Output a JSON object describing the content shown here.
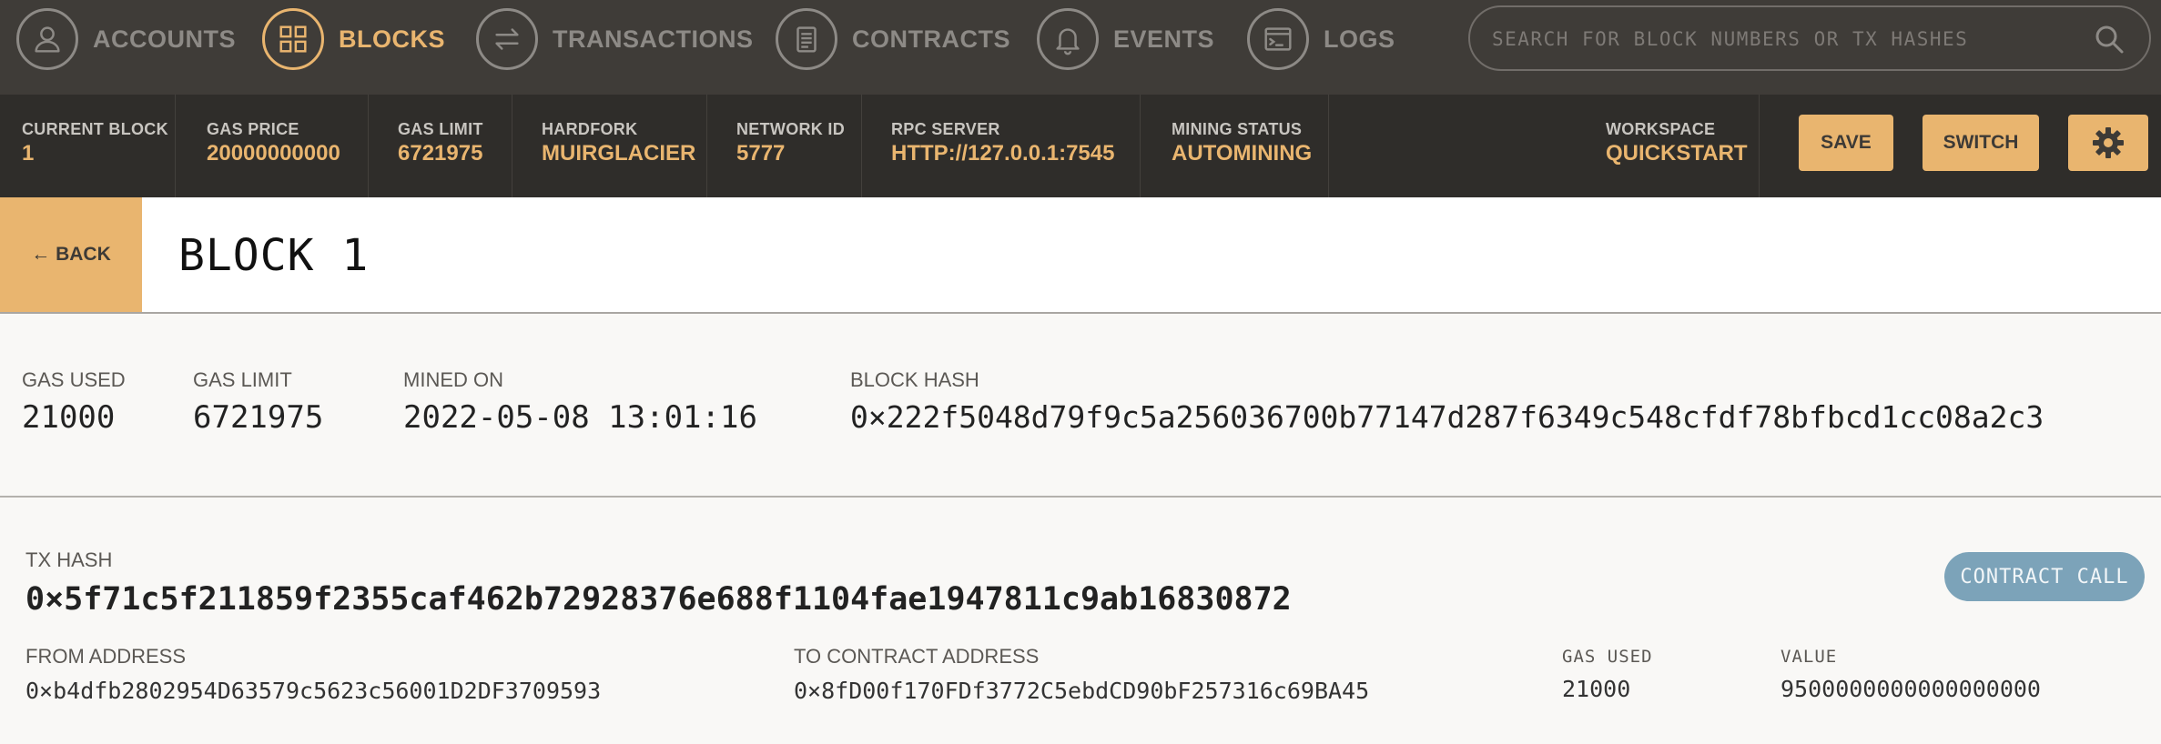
{
  "nav": {
    "items": [
      {
        "label": "ACCOUNTS",
        "icon": "user-icon"
      },
      {
        "label": "BLOCKS",
        "icon": "grid-icon",
        "active": true
      },
      {
        "label": "TRANSACTIONS",
        "icon": "arrows-icon"
      },
      {
        "label": "CONTRACTS",
        "icon": "document-icon"
      },
      {
        "label": "EVENTS",
        "icon": "bell-icon"
      },
      {
        "label": "LOGS",
        "icon": "terminal-icon"
      }
    ],
    "search_placeholder": "SEARCH FOR BLOCK NUMBERS OR TX HASHES"
  },
  "status": {
    "current_block": {
      "label": "CURRENT BLOCK",
      "value": "1"
    },
    "gas_price": {
      "label": "GAS PRICE",
      "value": "20000000000"
    },
    "gas_limit": {
      "label": "GAS LIMIT",
      "value": "6721975"
    },
    "hardfork": {
      "label": "HARDFORK",
      "value": "MUIRGLACIER"
    },
    "network_id": {
      "label": "NETWORK ID",
      "value": "5777"
    },
    "rpc_server": {
      "label": "RPC SERVER",
      "value": "HTTP://127.0.0.1:7545"
    },
    "mining_status": {
      "label": "MINING STATUS",
      "value": "AUTOMINING"
    },
    "workspace": {
      "label": "WORKSPACE",
      "value": "QUICKSTART"
    },
    "save_label": "SAVE",
    "switch_label": "SWITCH"
  },
  "page": {
    "back_label": "← BACK",
    "title": "BLOCK 1"
  },
  "block": {
    "gas_used": {
      "label": "GAS USED",
      "value": "21000"
    },
    "gas_limit": {
      "label": "GAS LIMIT",
      "value": "6721975"
    },
    "mined_on": {
      "label": "MINED ON",
      "value": "2022-05-08 13:01:16"
    },
    "block_hash": {
      "label": "BLOCK HASH",
      "value": "0×222f5048d79f9c5a256036700b77147d287f6349c548cfdf78bfbcd1cc08a2c3"
    }
  },
  "tx": {
    "hash_label": "TX HASH",
    "hash": "0×5f71c5f211859f2355caf462b72928376e688f1104fae1947811c9ab16830872",
    "type_badge": "CONTRACT CALL",
    "from_label": "FROM ADDRESS",
    "from": "0×b4dfb2802954D63579c5623c56001D2DF3709593",
    "to_label": "TO CONTRACT ADDRESS",
    "to": "0×8fD00f170FDf3772C5ebdCD90bF257316c69BA45",
    "gas_used_label": "GAS USED",
    "gas_used": "21000",
    "value_label": "VALUE",
    "value": "9500000000000000000"
  },
  "colors": {
    "accent": "#e9b56f",
    "nav_bg": "#3f3c38",
    "status_bg": "#2f2d2a",
    "badge": "#7ca3b9"
  }
}
